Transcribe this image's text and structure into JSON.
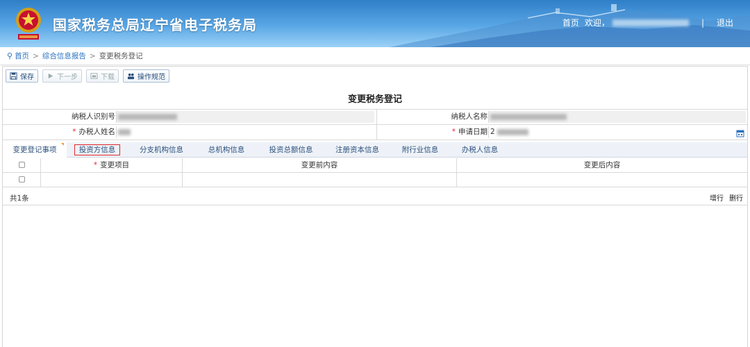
{
  "header": {
    "site_title": "国家税务总局辽宁省电子税务局",
    "nav_home": "首页",
    "nav_welcome": "欢迎，",
    "nav_sep": "|",
    "nav_logout": "退出"
  },
  "breadcrumb": {
    "home": "首页",
    "gt": ">",
    "section": "综合信息报告",
    "current": "变更税务登记"
  },
  "toolbar": {
    "save": "保存",
    "next": "下一步",
    "download": "下载",
    "guide": "操作规范"
  },
  "form": {
    "title": "变更税务登记",
    "taxpayer_id_label": "纳税人识别号",
    "taxpayer_name_label": "纳税人名称",
    "agent_name_label": "办税人姓名",
    "apply_date_label": "申请日期",
    "apply_date_prefix": "2"
  },
  "tabs": [
    {
      "label": "变更登记事项"
    },
    {
      "label": "投资方信息"
    },
    {
      "label": "分支机构信息"
    },
    {
      "label": "总机构信息"
    },
    {
      "label": "投资总额信息"
    },
    {
      "label": "注册资本信息"
    },
    {
      "label": "附行业信息"
    },
    {
      "label": "办税人信息"
    }
  ],
  "table": {
    "columns": [
      "变更项目",
      "变更前内容",
      "变更后内容"
    ],
    "count_text": "共1条",
    "add_row": "增行",
    "del_row": "删行"
  },
  "colors": {
    "header_blue": "#2f7fc8",
    "link_blue": "#2a72c2",
    "required_red": "#e23",
    "highlight_red": "#e0262e"
  }
}
